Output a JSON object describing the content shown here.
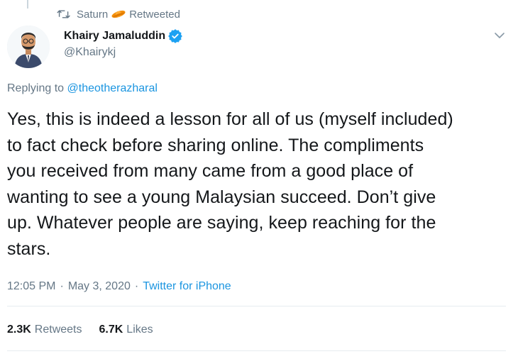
{
  "retweet": {
    "user": "Saturn",
    "label": "Retweeted",
    "icons": [
      "retweet-icon",
      "saturn-icon"
    ]
  },
  "author": {
    "display_name": "Khairy Jamaluddin",
    "handle": "@Khairykj",
    "verified": true,
    "avatar": "avatar"
  },
  "reply": {
    "prefix": "Replying to",
    "mention": "@theotherazharal"
  },
  "tweet": {
    "lines": [
      "Yes, this is indeed a lesson for all of us (myself included)",
      "to fact check before sharing online. The compliments",
      "you received from many came from a good place of",
      "wanting to see a young Malaysian succeed. Don’t give",
      "up. Whatever people are saying, keep reaching for the",
      "stars."
    ]
  },
  "meta": {
    "time": "12:05 PM",
    "sep1": "·",
    "date": "May 3, 2020",
    "sep2": "·",
    "source": "Twitter for iPhone"
  },
  "stats": {
    "retweets_count": "2.3K",
    "retweets_label": "Retweets",
    "likes_count": "6.7K",
    "likes_label": "Likes"
  },
  "colors": {
    "text": "#14171a",
    "secondary": "#657786",
    "link": "#1b95e0",
    "verified": "#1da1f2",
    "divider": "#e6ecf0"
  }
}
